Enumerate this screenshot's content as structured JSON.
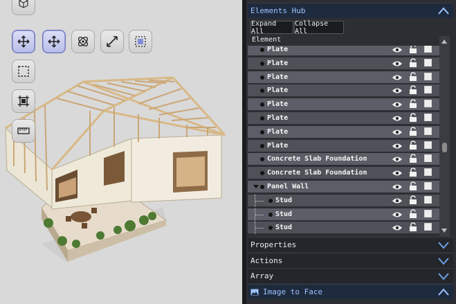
{
  "elements_hub": {
    "title": "Elements Hub",
    "expand_all": "Expand All",
    "collapse_all": "Collapse All",
    "column_header": "Element",
    "rows": [
      {
        "label": "Plate",
        "depth": 0
      },
      {
        "label": "Plate",
        "depth": 0
      },
      {
        "label": "Plate",
        "depth": 0
      },
      {
        "label": "Plate",
        "depth": 0
      },
      {
        "label": "Plate",
        "depth": 0
      },
      {
        "label": "Plate",
        "depth": 0
      },
      {
        "label": "Plate",
        "depth": 0
      },
      {
        "label": "Plate",
        "depth": 0
      },
      {
        "label": "Concrete Slab Foundation",
        "depth": 0
      },
      {
        "label": "Concrete Slab Foundation",
        "depth": 0
      },
      {
        "label": "Panel Wall",
        "depth": 0,
        "expanded": true
      },
      {
        "label": "Stud",
        "depth": 1
      },
      {
        "label": "Stud",
        "depth": 1
      },
      {
        "label": "Stud",
        "depth": 1
      }
    ]
  },
  "sections": {
    "properties": "Properties",
    "actions": "Actions",
    "array": "Array",
    "image_to_face": "Image to Face"
  },
  "toolbar": {
    "tools": [
      "move-tool",
      "move-tool",
      "orbit-tool",
      "scale-tool",
      "snap-tool",
      "select-box-tool",
      "frame-tool",
      "measure-tool"
    ]
  },
  "colors": {
    "panel_bg": "#2c2e33",
    "row_bg": "#5b5e66",
    "accent_blue": "#9ec3ff",
    "tool_active": "#b9bde8"
  }
}
